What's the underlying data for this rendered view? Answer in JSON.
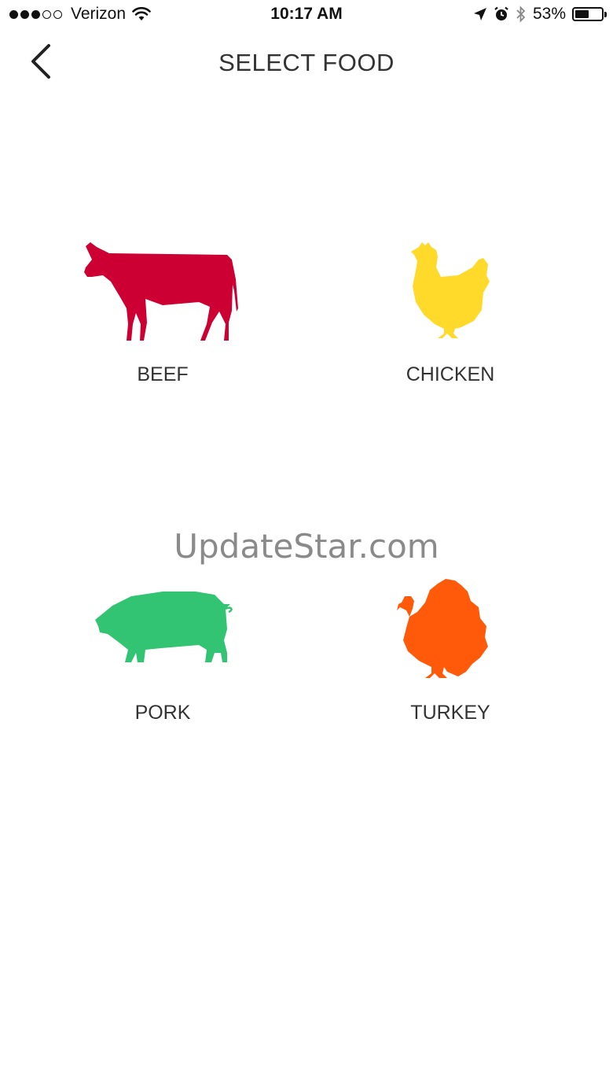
{
  "status_bar": {
    "carrier": "Verizon",
    "signal_bars": 3,
    "signal_total": 5,
    "time": "10:17 AM",
    "battery_percent": "53%",
    "battery_level": 0.53
  },
  "header": {
    "title": "SELECT FOOD"
  },
  "foods": [
    {
      "label": "BEEF",
      "icon": "cow-icon",
      "color": "#CC0033"
    },
    {
      "label": "CHICKEN",
      "icon": "chicken-icon",
      "color": "#FFDA2A"
    },
    {
      "label": "PORK",
      "icon": "pig-icon",
      "color": "#33C473"
    },
    {
      "label": "TURKEY",
      "icon": "turkey-icon",
      "color": "#FF5A0A"
    }
  ],
  "watermark": "UpdateStar.com"
}
